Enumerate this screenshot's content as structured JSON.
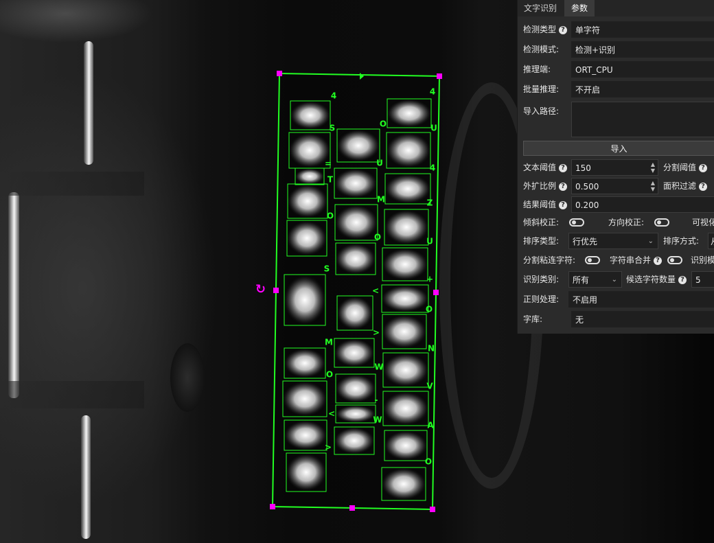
{
  "tabs": [
    {
      "label": "文字识别",
      "active": false
    },
    {
      "label": "参数",
      "active": true
    }
  ],
  "params": {
    "detect_type": {
      "label": "检测类型",
      "value": "单字符"
    },
    "detect_mode": {
      "label": "检测模式:",
      "value": "检测+识别"
    },
    "infer_end": {
      "label": "推理端:",
      "value": "ORT_CPU"
    },
    "batch_infer": {
      "label": "批量推理:",
      "value": "不开启"
    },
    "import_path": {
      "label": "导入路径:",
      "value": ""
    },
    "import_button": "导入",
    "text_threshold": {
      "label": "文本阈值",
      "value": "150"
    },
    "split_threshold": {
      "label": "分割阈值"
    },
    "expand_ratio": {
      "label": "外扩比例",
      "value": "0.500"
    },
    "area_filter": {
      "label": "面积过滤"
    },
    "result_threshold": {
      "label": "结果阈值",
      "value": "0.200"
    },
    "tilt_correction": {
      "label": "倾斜校正:",
      "on": false
    },
    "direction_correction": {
      "label": "方向校正:",
      "on": false
    },
    "visualize": {
      "label": "可视化"
    },
    "sort_type": {
      "label": "排序类型:",
      "value": "行优先"
    },
    "sort_method": {
      "label": "排序方式:",
      "value": "从"
    },
    "split_sticky": {
      "label": "分割粘连字符:",
      "on": false
    },
    "char_merge": {
      "label": "字符串合并",
      "on": false
    },
    "recog_model": {
      "label": "识别模"
    },
    "recog_category": {
      "label": "识别类别:",
      "value": "所有"
    },
    "candidate_count": {
      "label": "候选字符数量",
      "value": "5"
    },
    "regex": {
      "label": "正则处理:",
      "value": "不启用"
    },
    "charset": {
      "label": "字库:",
      "value": "无"
    }
  },
  "colors": {
    "box": "#22ff22",
    "handle": "#ff00ff",
    "panel_bg": "#2b2b2b"
  },
  "detections": [
    {
      "char": "4"
    },
    {
      "char": "4"
    },
    {
      "char": "S"
    },
    {
      "char": "O"
    },
    {
      "char": "U"
    },
    {
      "char": "="
    },
    {
      "char": "U"
    },
    {
      "char": "4"
    },
    {
      "char": "T"
    },
    {
      "char": "M"
    },
    {
      "char": "Z"
    },
    {
      "char": "O"
    },
    {
      "char": "O"
    },
    {
      "char": "U"
    },
    {
      "char": "S"
    },
    {
      "char": "+"
    },
    {
      "char": "<"
    },
    {
      "char": "O"
    },
    {
      "char": ">"
    },
    {
      "char": "M"
    },
    {
      "char": "N"
    },
    {
      "char": "W"
    },
    {
      "char": "O"
    },
    {
      "char": "V"
    },
    {
      "char": "-"
    },
    {
      "char": "<"
    },
    {
      "char": "W"
    },
    {
      "char": "A"
    },
    {
      "char": ">"
    },
    {
      "char": "O"
    }
  ]
}
